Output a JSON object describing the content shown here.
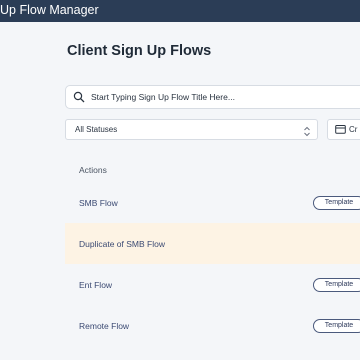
{
  "app": {
    "title": "Up Flow Manager"
  },
  "page": {
    "title": "Client Sign Up Flows"
  },
  "search": {
    "placeholder": "Start Typing Sign Up Flow Title Here..."
  },
  "filters": {
    "status_value": "All Statuses",
    "date_button_label": "Cr"
  },
  "table": {
    "header": "Actions",
    "rows": [
      {
        "name": "SMB Flow",
        "badge": "Template"
      },
      {
        "name": "Duplicate of SMB Flow",
        "badge": ""
      },
      {
        "name": "Ent Flow",
        "badge": "Template"
      },
      {
        "name": "Remote Flow",
        "badge": "Template"
      }
    ]
  },
  "colors": {
    "topbar": "#2b3d56",
    "highlight_row": "#fdf3e4",
    "row_text": "#3b4a73"
  }
}
